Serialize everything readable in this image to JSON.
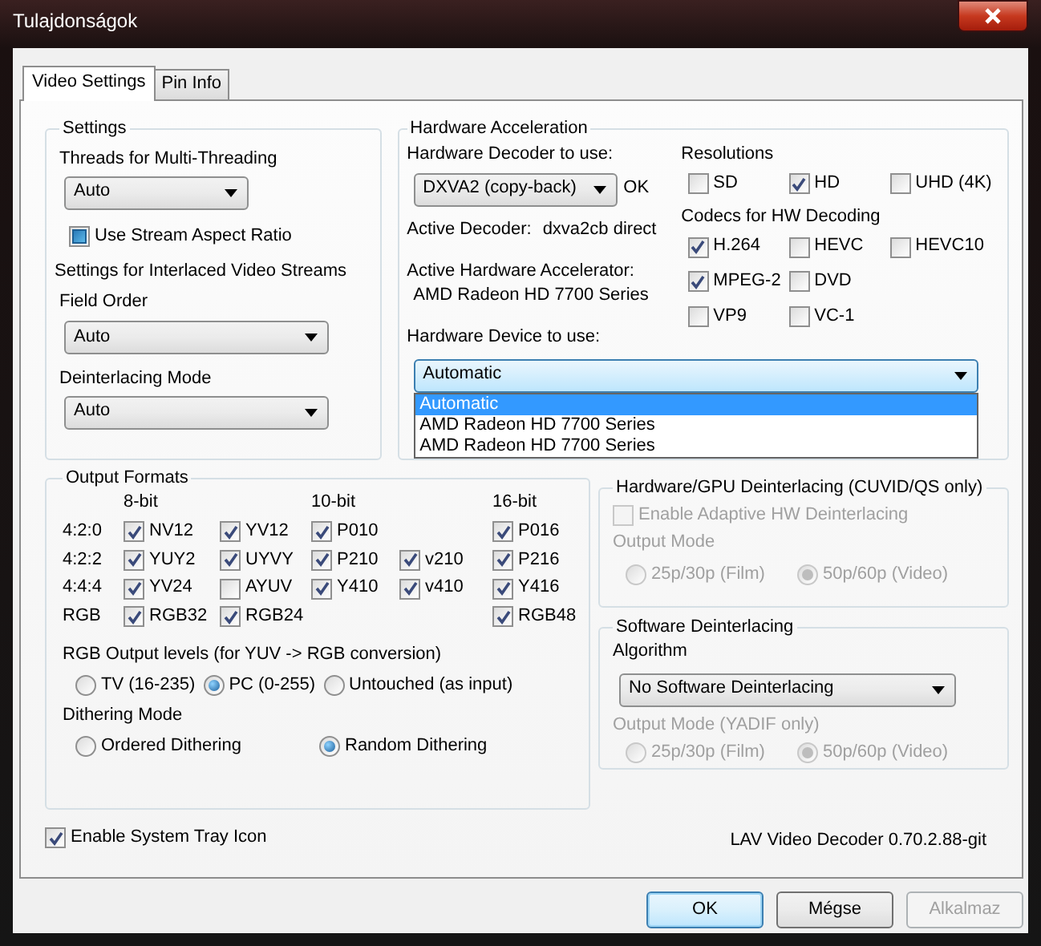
{
  "window": {
    "title": "Tulajdonságok"
  },
  "tabs": [
    {
      "label": "Video Settings",
      "selected": true
    },
    {
      "label": "Pin Info",
      "selected": false
    }
  ],
  "settings": {
    "title": "Settings",
    "threads_label": "Threads for Multi-Threading",
    "threads_value": "Auto",
    "stream_aspect": {
      "label": "Use Stream Aspect Ratio",
      "checked": false,
      "indeterminate": true
    },
    "interlaced_label": "Settings for Interlaced Video Streams",
    "field_order_label": "Field Order",
    "field_order_value": "Auto",
    "deint_mode_label": "Deinterlacing Mode",
    "deint_mode_value": "Auto"
  },
  "hw": {
    "title": "Hardware Acceleration",
    "decoder_label": "Hardware Decoder to use:",
    "decoder_value": "DXVA2 (copy-back)",
    "decoder_status": "OK",
    "active_decoder_label": "Active Decoder:",
    "active_decoder_value": "dxva2cb direct",
    "accel_label": "Active Hardware Accelerator:",
    "accel_value": "AMD Radeon HD 7700 Series",
    "device_label": "Hardware Device to use:",
    "device_value": "Automatic",
    "device_options": [
      {
        "label": "Automatic",
        "selected": true
      },
      {
        "label": "AMD Radeon HD 7700 Series",
        "selected": false
      },
      {
        "label": "AMD Radeon HD 7700 Series",
        "selected": false
      }
    ],
    "resolutions_label": "Resolutions",
    "resolutions": [
      {
        "label": "SD",
        "checked": false
      },
      {
        "label": "HD",
        "checked": true
      },
      {
        "label": "UHD (4K)",
        "checked": false
      }
    ],
    "codecs_label": "Codecs for HW Decoding",
    "codecs": [
      [
        {
          "label": "H.264",
          "checked": true
        },
        {
          "label": "HEVC",
          "checked": false
        },
        {
          "label": "HEVC10",
          "checked": false
        }
      ],
      [
        {
          "label": "MPEG-2",
          "checked": true
        },
        {
          "label": "DVD",
          "checked": false
        }
      ],
      [
        {
          "label": "VP9",
          "checked": false
        },
        {
          "label": "VC-1",
          "checked": false
        }
      ]
    ]
  },
  "output_formats": {
    "title": "Output Formats",
    "headers": [
      {
        "kind": "header",
        "label": "8-bit"
      },
      {
        "kind": "empty"
      },
      {
        "kind": "header",
        "label": "10-bit"
      },
      {
        "kind": "empty"
      },
      {
        "kind": "header",
        "label": "16-bit"
      }
    ],
    "rows": [
      {
        "label": "4:2:0",
        "formats": [
          {
            "label": "NV12",
            "checked": true
          },
          {
            "label": "YV12",
            "checked": true
          },
          {
            "label": "P010",
            "checked": true
          },
          {
            "kind": "empty"
          },
          {
            "label": "P016",
            "checked": true
          }
        ]
      },
      {
        "label": "4:2:2",
        "formats": [
          {
            "label": "YUY2",
            "checked": true
          },
          {
            "label": "UYVY",
            "checked": true
          },
          {
            "label": "P210",
            "checked": true
          },
          {
            "label": "v210",
            "checked": true
          },
          {
            "label": "P216",
            "checked": true
          }
        ]
      },
      {
        "label": "4:4:4",
        "formats": [
          {
            "label": "YV24",
            "checked": true
          },
          {
            "label": "AYUV",
            "checked": false
          },
          {
            "label": "Y410",
            "checked": true
          },
          {
            "label": "v410",
            "checked": true
          },
          {
            "label": "Y416",
            "checked": true
          }
        ]
      },
      {
        "label": "RGB",
        "formats": [
          {
            "label": "RGB32",
            "checked": true
          },
          {
            "label": "RGB24",
            "checked": true
          },
          {
            "kind": "empty"
          },
          {
            "kind": "empty"
          },
          {
            "label": "RGB48",
            "checked": true
          }
        ]
      }
    ],
    "rgb_levels_label": "RGB Output levels (for YUV -> RGB conversion)",
    "rgb_levels": [
      {
        "label": "TV (16-235)",
        "selected": false
      },
      {
        "label": "PC (0-255)",
        "selected": true
      },
      {
        "label": "Untouched (as input)",
        "selected": false
      }
    ],
    "dithering_label": "Dithering Mode",
    "dithering": [
      {
        "label": "Ordered Dithering",
        "selected": false
      },
      {
        "label": "Random Dithering",
        "selected": true
      }
    ]
  },
  "hw_deint": {
    "title": "Hardware/GPU Deinterlacing (CUVID/QS only)",
    "disabled": true,
    "enable": {
      "label": "Enable Adaptive HW Deinterlacing",
      "checked": false
    },
    "output_mode_label": "Output Mode",
    "modes": [
      {
        "label": "25p/30p (Film)",
        "selected": false
      },
      {
        "label": "50p/60p (Video)",
        "selected": true
      }
    ]
  },
  "sw_deint": {
    "title": "Software Deinterlacing",
    "algorithm_label": "Algorithm",
    "algorithm_value": "No Software Deinterlacing",
    "output_mode_label": "Output Mode (YADIF only)",
    "output_disabled": true,
    "modes": [
      {
        "label": "25p/30p (Film)",
        "selected": false
      },
      {
        "label": "50p/60p (Video)",
        "selected": true
      }
    ]
  },
  "tray": {
    "label": "Enable System Tray Icon",
    "checked": true
  },
  "version": "LAV Video Decoder 0.70.2.88-git",
  "buttons": [
    {
      "label": "OK",
      "default": true,
      "disabled": false
    },
    {
      "label": "Mégse",
      "default": false,
      "disabled": false
    },
    {
      "label": "Alkalmaz",
      "default": false,
      "disabled": true
    }
  ]
}
